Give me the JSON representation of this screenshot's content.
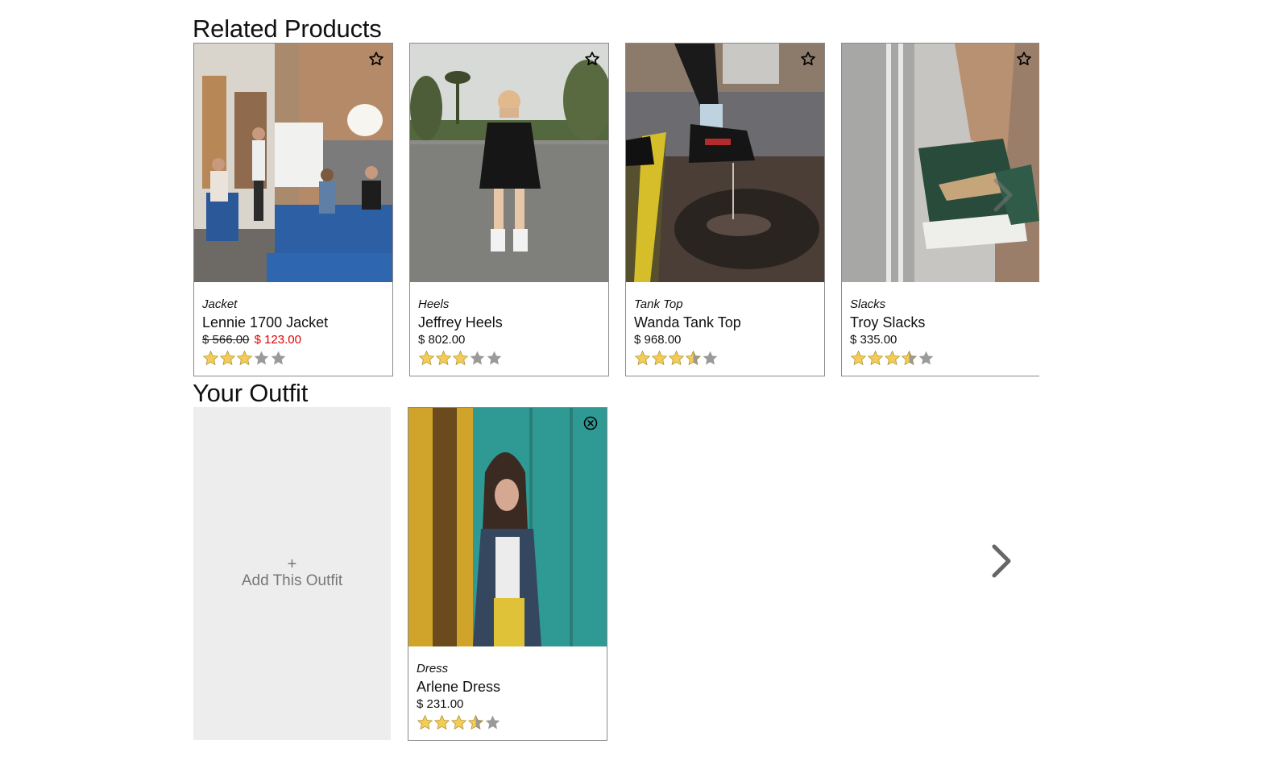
{
  "related": {
    "title": "Related Products",
    "products": [
      {
        "category": "Jacket",
        "name": "Lennie 1700 Jacket",
        "original_price": "$ 566.00",
        "sale_price": "$ 123.00",
        "rating": 3,
        "image": "office-meeting-photo"
      },
      {
        "category": "Heels",
        "name": "Jeffrey Heels",
        "price": "$ 802.00",
        "rating": 3,
        "image": "woman-black-dress-street-photo"
      },
      {
        "category": "Tank Top",
        "name": "Wanda Tank Top",
        "price": "$ 968.00",
        "rating": 3.5,
        "image": "sneaker-puddle-photo"
      },
      {
        "category": "Slacks",
        "name": "Troy Slacks",
        "price": "$ 335.00",
        "rating": 3.5,
        "image": "green-sneakers-photo"
      }
    ],
    "action_icon": "star-outline-icon",
    "next_icon": "chevron-right-icon"
  },
  "outfit": {
    "title": "Your Outfit",
    "add_plus": "+",
    "add_label": "Add This Outfit",
    "items": [
      {
        "category": "Dress",
        "name": "Arlene Dress",
        "price": "$ 231.00",
        "rating": 3.5,
        "image": "woman-teal-wall-photo"
      }
    ],
    "remove_icon": "close-circle-icon",
    "next_icon": "chevron-right-icon"
  },
  "colors": {
    "star_filled": "#f3cc56",
    "star_empty": "#9a9a9a",
    "sale_price": "#e00000",
    "add_card_bg": "#ededed",
    "card_border": "#8a8a8a"
  }
}
